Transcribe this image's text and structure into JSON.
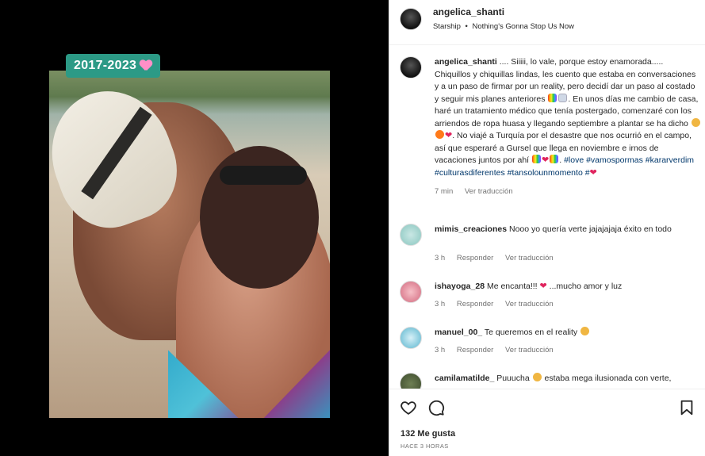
{
  "media": {
    "badge_text": "2017-2023",
    "badge_emoji": "heart-with-ribbon-icon"
  },
  "post_header": {
    "username": "angelica_shanti",
    "song_artist": "Starship",
    "separator": "•",
    "song_title": "Nothing's Gonna Stop Us Now"
  },
  "caption": {
    "username": "angelica_shanti",
    "p1": " .... Siiiii, lo vale, porque estoy enamorada..... Chiquillos y chiquillas lindas, les cuento que estaba en conversaciones y a un paso de firmar por un reality, pero decidí dar un paso al costado y seguir mis planes anteriores ",
    "p2": ". En unos días me cambio de casa, haré un tratamiento médico que tenía postergado, comenzaré con los arriendos de ropa huasa y llegando septiembre a plantar se ha dicho ",
    "p3": ". No viajé a Turquía por el desastre que nos ocurrió en el campo, así que esperaré a Gursel que llega en noviembre e irnos de vacaciones juntos por ahí ",
    "p4": ". ",
    "tags": "#love #vamospormas #kararverdim #culturasdiferentes #tansolounmomento #",
    "time": "7 min",
    "translate": "Ver traducción"
  },
  "comments": [
    {
      "username": "mimis_creaciones",
      "text": " Nooo yo quería verte jajajajaja éxito en todo",
      "time": "3 h",
      "reply": "Responder",
      "translate": "Ver traducción"
    },
    {
      "username": "ishayoga_28",
      "text": " Me encanta!!! ",
      "text2": " ...mucho amor y luz",
      "time": "3 h",
      "reply": "Responder",
      "translate": "Ver traducción"
    },
    {
      "username": "manuel_00_",
      "text": " Te queremos en el reality ",
      "time": "3 h",
      "reply": "Responder",
      "translate": "Ver traducción"
    },
    {
      "username": "camilamatilde_",
      "text": " Puuucha ",
      "text2": " estaba mega ilusionada con verte,"
    }
  ],
  "footer": {
    "likes": "132 Me gusta",
    "ago": "HACE 3 HORAS"
  },
  "colors": {
    "badge_bg": "#2c9a86",
    "hashtag": "#00376b",
    "heart": "#e0245e"
  }
}
